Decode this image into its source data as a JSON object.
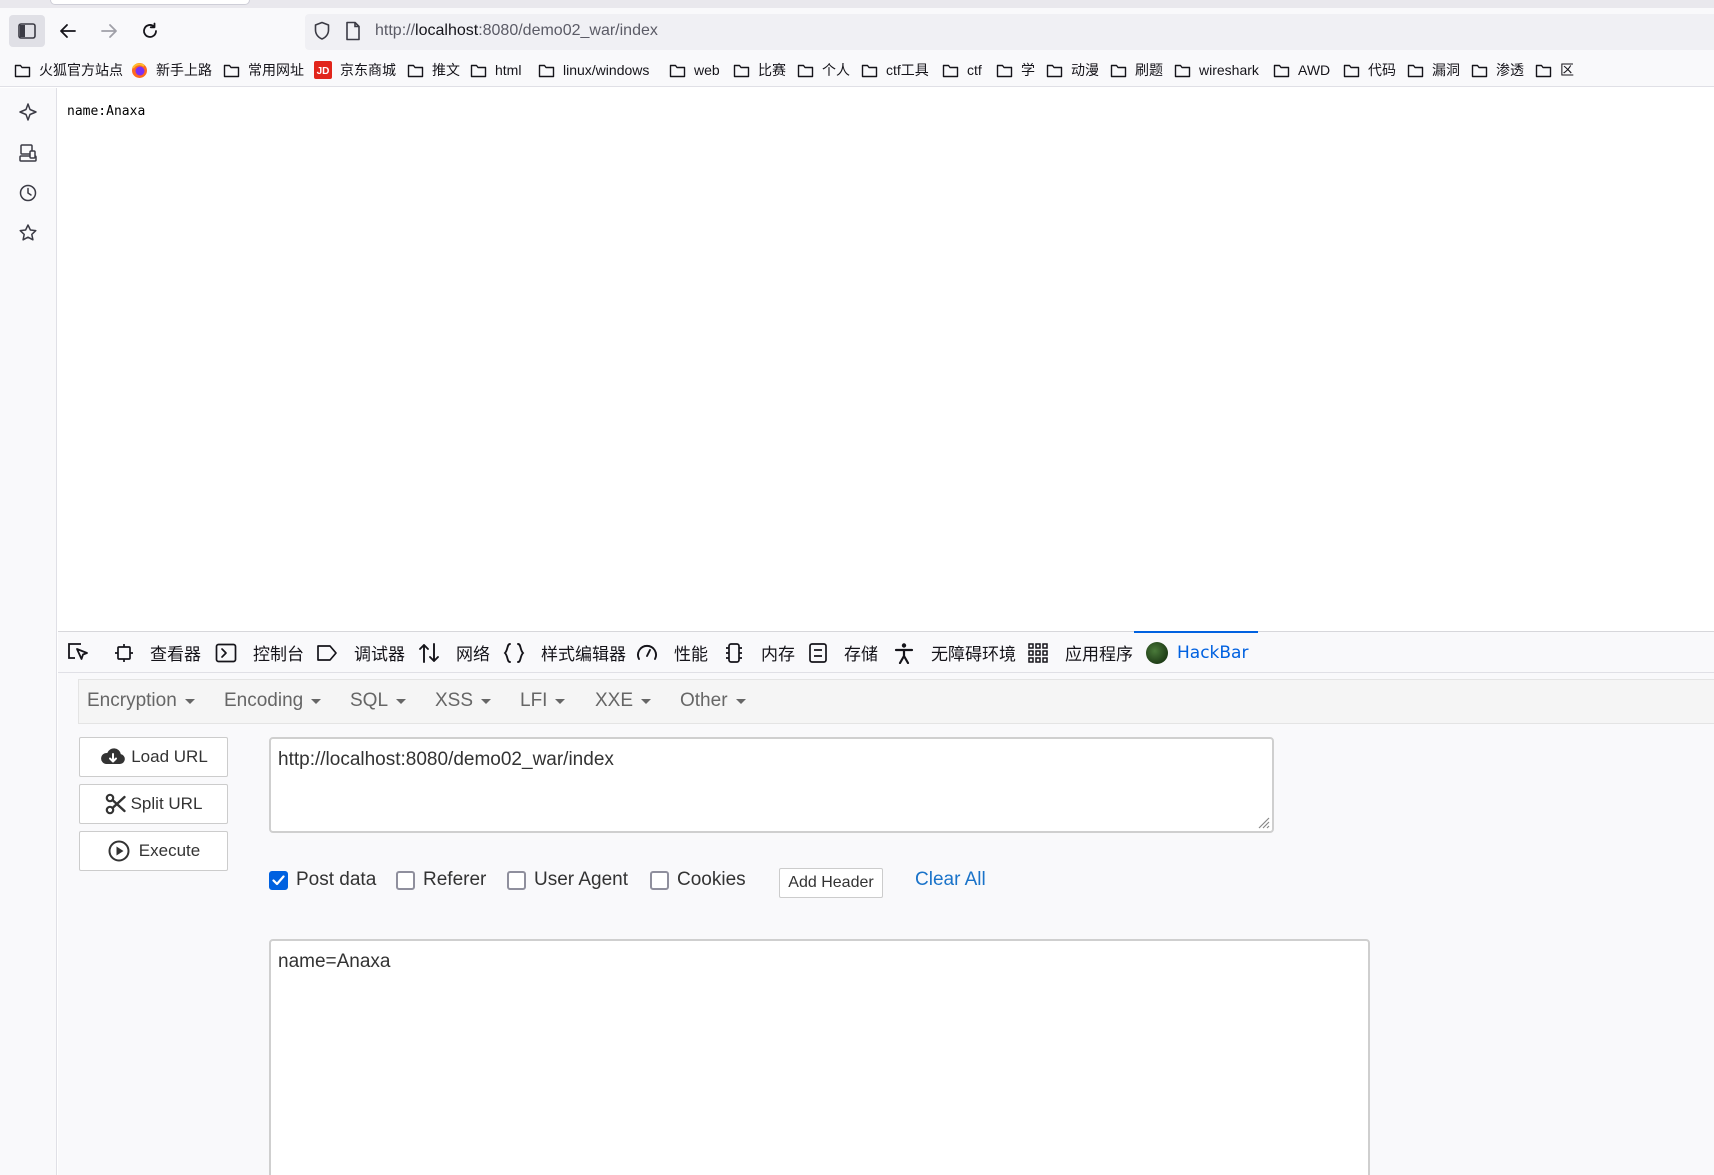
{
  "browser": {
    "url": {
      "scheme": "http://",
      "host": "localhost",
      "rest": ":8080/demo02_war/index"
    }
  },
  "bookmarks": [
    {
      "label": "火狐官方站点",
      "icon": "folder-icon"
    },
    {
      "label": "新手上路",
      "icon": "firefox-icon"
    },
    {
      "label": "常用网址",
      "icon": "folder-icon"
    },
    {
      "label": "京东商城",
      "icon": "jd-icon"
    },
    {
      "label": "推文",
      "icon": "folder-icon"
    },
    {
      "label": "html",
      "icon": "folder-icon"
    },
    {
      "label": "linux/windows",
      "icon": "folder-icon"
    },
    {
      "label": "web",
      "icon": "folder-icon"
    },
    {
      "label": "比赛",
      "icon": "folder-icon"
    },
    {
      "label": "个人",
      "icon": "folder-icon"
    },
    {
      "label": "ctf工具",
      "icon": "folder-icon"
    },
    {
      "label": "ctf",
      "icon": "folder-icon"
    },
    {
      "label": "学",
      "icon": "folder-icon"
    },
    {
      "label": "动漫",
      "icon": "folder-icon"
    },
    {
      "label": "刷题",
      "icon": "folder-icon"
    },
    {
      "label": "wireshark",
      "icon": "folder-icon"
    },
    {
      "label": "AWD",
      "icon": "folder-icon"
    },
    {
      "label": "代码",
      "icon": "folder-icon"
    },
    {
      "label": "漏洞",
      "icon": "folder-icon"
    },
    {
      "label": "渗透",
      "icon": "folder-icon"
    },
    {
      "label": "区",
      "icon": "folder-icon"
    }
  ],
  "page": {
    "body_text": "name:Anaxa"
  },
  "devtools": {
    "tabs": [
      {
        "label": "查看器",
        "icon": "inspector-icon"
      },
      {
        "label": "控制台",
        "icon": "console-icon"
      },
      {
        "label": "调试器",
        "icon": "debugger-icon"
      },
      {
        "label": "网络",
        "icon": "network-icon"
      },
      {
        "label": "样式编辑器",
        "icon": "style-editor-icon"
      },
      {
        "label": "性能",
        "icon": "performance-icon"
      },
      {
        "label": "内存",
        "icon": "memory-icon"
      },
      {
        "label": "存储",
        "icon": "storage-icon"
      },
      {
        "label": "无障碍环境",
        "icon": "accessibility-icon"
      },
      {
        "label": "应用程序",
        "icon": "application-icon"
      },
      {
        "label": "HackBar",
        "icon": "hackbar-logo-icon",
        "active": true
      }
    ]
  },
  "hackbar": {
    "menu": [
      "Encryption",
      "Encoding",
      "SQL",
      "XSS",
      "LFI",
      "XXE",
      "Other"
    ],
    "buttons": {
      "load_url": "Load URL",
      "split_url": "Split URL",
      "execute": "Execute"
    },
    "url_value": "http://localhost:8080/demo02_war/index",
    "options": {
      "post_data": {
        "label": "Post data",
        "checked": true
      },
      "referer": {
        "label": "Referer",
        "checked": false
      },
      "user_agent": {
        "label": "User Agent",
        "checked": false
      },
      "cookies": {
        "label": "Cookies",
        "checked": false
      }
    },
    "add_header": "Add Header",
    "clear_all": "Clear All",
    "post_body": "name=Anaxa"
  },
  "colors": {
    "accent": "#0061e0",
    "link": "#1a73c9"
  }
}
